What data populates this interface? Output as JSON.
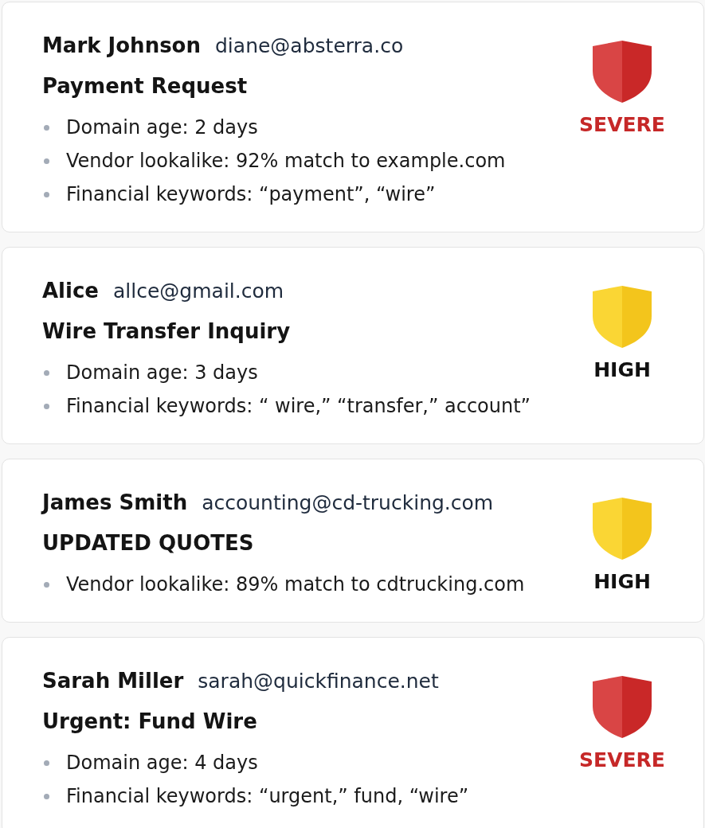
{
  "alerts": [
    {
      "sender": "Mark Johnson",
      "email": "diane@absterra.co",
      "subject": "Payment Request",
      "indicators": [
        "Domain age: 2 days",
        "Vendor lookalike: 92% match to example.com",
        "Financial keywords: “payment”, “wire”"
      ],
      "kind": "severe",
      "severity_label": "SEVERE"
    },
    {
      "sender": "Alice",
      "email": "allce@gmail.com",
      "subject": "Wire Transfer Inquiry",
      "indicators": [
        "Domain age: 3 days",
        "Financial keywords: “ wire,” “transfer,” account”"
      ],
      "kind": "high",
      "severity_label": "HIGH"
    },
    {
      "sender": "James Smith",
      "email": "accounting@cd-trucking.com",
      "subject": "UPDATED QUOTES",
      "indicators": [
        "Vendor lookalike: 89% match to cdtrucking.com"
      ],
      "kind": "high",
      "severity_label": "HIGH"
    },
    {
      "sender": "Sarah Miller",
      "email": "sarah@quickfinance.net",
      "subject": "Urgent: Fund Wire",
      "indicators": [
        "Domain age: 4 days",
        "Financial keywords: “urgent,” fund, “wire”"
      ],
      "kind": "severe",
      "severity_label": "SEVERE"
    }
  ]
}
